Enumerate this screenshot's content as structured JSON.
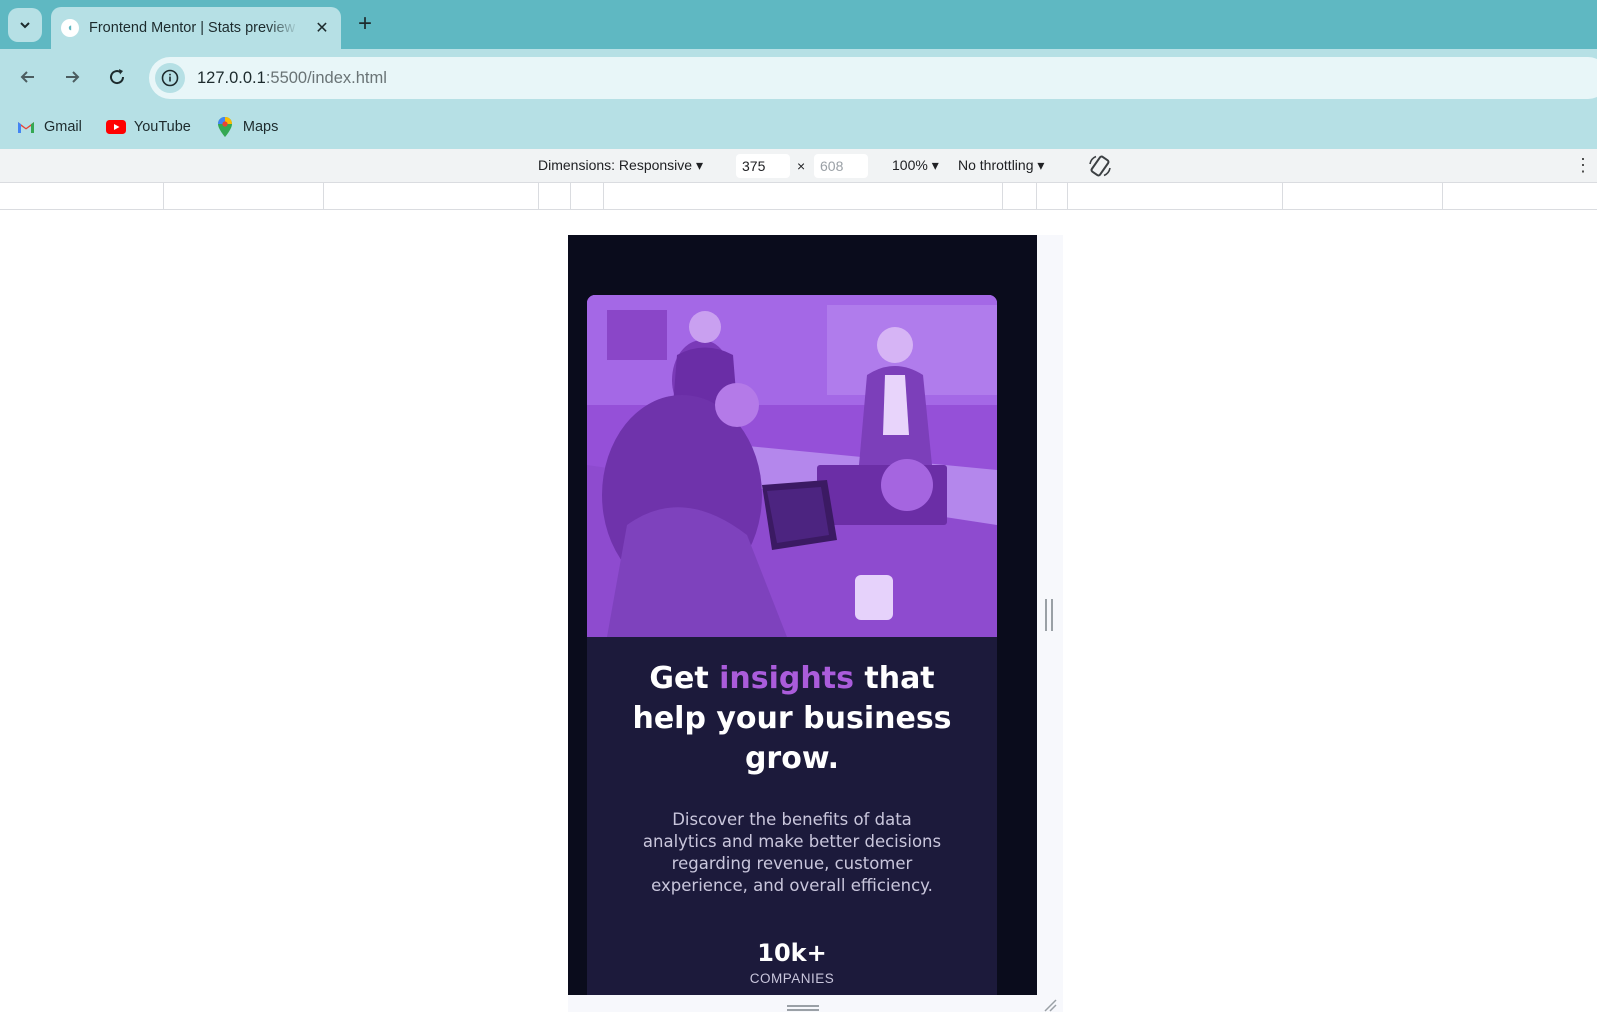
{
  "browser": {
    "tab": {
      "title": "Frontend Mentor | Stats preview card component",
      "close_glyph": "✕"
    },
    "new_tab_glyph": "+",
    "address": {
      "host": "127.0.0.1",
      "rest": ":5500/index.html"
    },
    "bookmarks": [
      {
        "label": "Gmail",
        "icon": "gmail-icon"
      },
      {
        "label": "YouTube",
        "icon": "youtube-icon"
      },
      {
        "label": "Maps",
        "icon": "maps-icon"
      }
    ]
  },
  "devtools": {
    "dimensions_label": "Dimensions: Responsive",
    "width_value": "375",
    "height_placeholder": "608",
    "times_glyph": "×",
    "zoom_label": "100%",
    "throttling_label": "No throttling",
    "dropdown_glyph": "▾"
  },
  "card": {
    "title_before": "Get ",
    "title_accent": "insights",
    "title_after": " that help your business grow.",
    "description": "Discover the benefits of data analytics and make better decisions regarding revenue, customer experience, and overall efficiency.",
    "stat": {
      "value": "10k+",
      "label": "COMPANIES"
    }
  },
  "colors": {
    "tab_strip": "#5fb8c2",
    "toolbar": "#b6e0e5",
    "page_bg": "#0a0c1c",
    "card_bg": "#1c1a3b",
    "accent": "#aa5cdb",
    "hero_overlay": "#9b4ee0"
  }
}
